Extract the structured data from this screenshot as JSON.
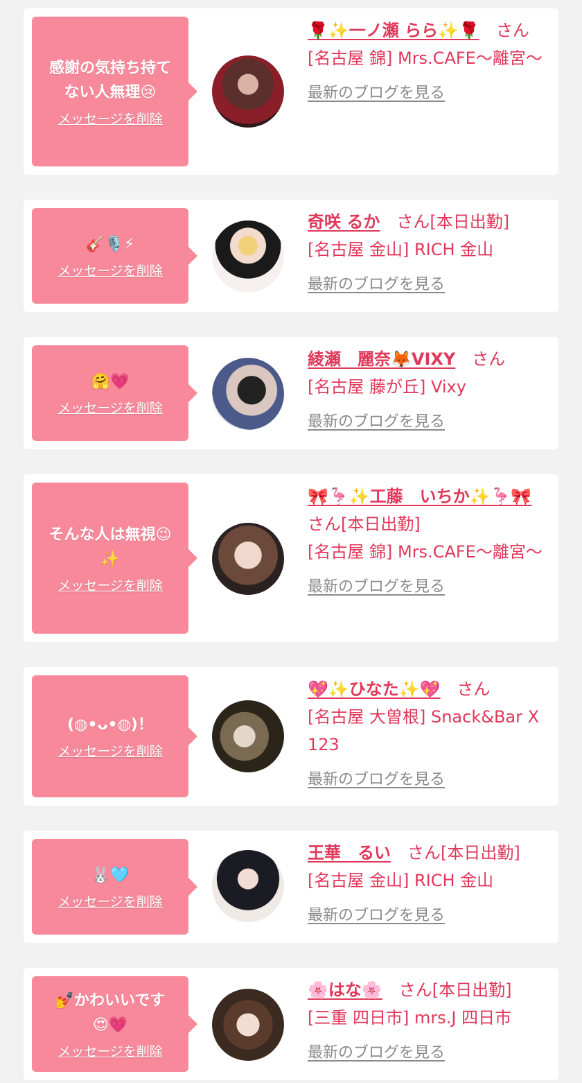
{
  "cards": [
    {
      "message": "感謝の気持ち持て\nない人無理😢",
      "delete_label": "メッセージを削除",
      "name": "🌹✨一ノ瀬 らら✨🌹",
      "san": "さん",
      "shop": "[名古屋 錦] Mrs.CAFE〜離宮〜",
      "blog_link": "最新のブログを見る",
      "avatar_icon": "avatar-photo"
    },
    {
      "message": "🎸🎙️⚡",
      "delete_label": "メッセージを削除",
      "name": "奇咲 るか",
      "san": "さん[本日出勤]",
      "shop": "[名古屋 金山] RICH 金山",
      "blog_link": "最新のブログを見る",
      "avatar_icon": "avatar-photo"
    },
    {
      "message": "🤗💗",
      "delete_label": "メッセージを削除",
      "name": "綾瀬　麗奈🦊VIXY",
      "san": "さん",
      "shop": "[名古屋 藤が丘] Vixy",
      "blog_link": "最新のブログを見る",
      "avatar_icon": "avatar-photo"
    },
    {
      "message": "そんな人は無視😉\n✨",
      "delete_label": "メッセージを削除",
      "name": "🎀🦩✨工藤　いちか✨🦩🎀",
      "san": "さん[本日出勤]",
      "shop": "[名古屋 錦] Mrs.CAFE〜離宮〜",
      "blog_link": "最新のブログを見る",
      "avatar_icon": "avatar-photo"
    },
    {
      "message": "(◍•ᴗ•◍)！",
      "delete_label": "メッセージを削除",
      "name": "💖✨ひなた✨💖",
      "san": "さん",
      "shop": "[名古屋 大曽根] Snack&Bar X 123",
      "blog_link": "最新のブログを見る",
      "avatar_icon": "avatar-photo"
    },
    {
      "message": "🐰🩵",
      "delete_label": "メッセージを削除",
      "name": "王華　るい",
      "san": "さん[本日出勤]",
      "shop": "[名古屋 金山] RICH 金山",
      "blog_link": "最新のブログを見る",
      "avatar_icon": "avatar-photo"
    },
    {
      "message": "💅かわいいです\n😍💗",
      "delete_label": "メッセージを削除",
      "name": "🌸はな🌸",
      "san": "さん[本日出勤]",
      "shop": "[三重 四日市] mrs.J 四日市",
      "blog_link": "最新のブログを見る",
      "avatar_icon": "avatar-photo"
    }
  ],
  "colors": {
    "accent": "#e0385a",
    "bubble": "#f7899b",
    "link_gray": "#8a8a8a",
    "page_bg": "#f2f2f2"
  }
}
